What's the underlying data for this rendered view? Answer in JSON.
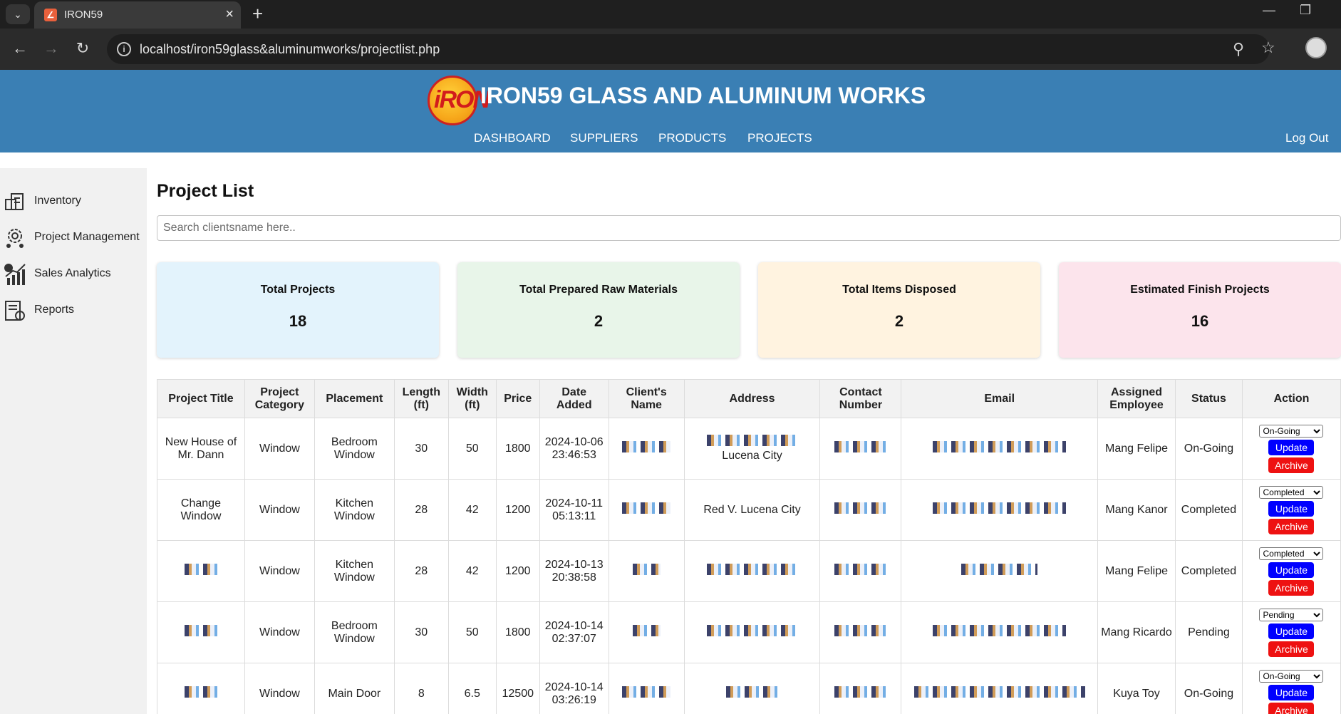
{
  "browser": {
    "tab_title": "IRON59",
    "url": "localhost/iron59glass&aluminumworks/projectlist.php"
  },
  "header": {
    "logo_text": "iRON",
    "title": "IRON59 GLASS AND ALUMINUM WORKS",
    "nav": [
      "DASHBOARD",
      "SUPPLIERS",
      "PRODUCTS",
      "PROJECTS"
    ],
    "logout": "Log Out"
  },
  "sidebar": {
    "items": [
      {
        "label": "Inventory",
        "icon": "inventory-icon"
      },
      {
        "label": "Project Management",
        "icon": "gear-people-icon"
      },
      {
        "label": "Sales Analytics",
        "icon": "chart-growth-icon"
      },
      {
        "label": "Reports",
        "icon": "report-icon"
      }
    ]
  },
  "main": {
    "title": "Project List",
    "search_placeholder": "Search clientsname here..",
    "cards": [
      {
        "label": "Total Projects",
        "value": "18",
        "color": "#e3f3fc"
      },
      {
        "label": "Total Prepared Raw Materials",
        "value": "2",
        "color": "#e8f5e9"
      },
      {
        "label": "Total Items Disposed",
        "value": "2",
        "color": "#fff3e0"
      },
      {
        "label": "Estimated Finish Projects",
        "value": "16",
        "color": "#fce4ec"
      }
    ],
    "table": {
      "headers": [
        "Project Title",
        "Project Category",
        "Placement",
        "Length (ft)",
        "Width (ft)",
        "Price",
        "Date Added",
        "Client's Name",
        "Address",
        "Contact Number",
        "Email",
        "Assigned Employee",
        "Status",
        "Action"
      ],
      "rows": [
        {
          "title": "New House of Mr. Dann",
          "category": "Window",
          "placement": "Bedroom Window",
          "length": "30",
          "width": "50",
          "price": "1800",
          "date": "2024-10-06 23:46:53",
          "address": "Lucena City",
          "employee": "Mang Felipe",
          "status": "On-Going",
          "select": "On-Going"
        },
        {
          "title": "Change Window",
          "category": "Window",
          "placement": "Kitchen Window",
          "length": "28",
          "width": "42",
          "price": "1200",
          "date": "2024-10-11 05:13:11",
          "address": "Red V. Lucena City",
          "employee": "Mang Kanor",
          "status": "Completed",
          "select": "Completed"
        },
        {
          "title": "",
          "category": "Window",
          "placement": "Kitchen Window",
          "length": "28",
          "width": "42",
          "price": "1200",
          "date": "2024-10-13 20:38:58",
          "address": "",
          "employee": "Mang Felipe",
          "status": "Completed",
          "select": "Completed"
        },
        {
          "title": "",
          "category": "Window",
          "placement": "Bedroom Window",
          "length": "30",
          "width": "50",
          "price": "1800",
          "date": "2024-10-14 02:37:07",
          "address": "",
          "employee": "Mang Ricardo",
          "status": "Pending",
          "select": "Pending"
        },
        {
          "title": "",
          "category": "Window",
          "placement": "Main Door",
          "length": "8",
          "width": "6.5",
          "price": "12500",
          "date": "2024-10-14 03:26:19",
          "address": "",
          "employee": "Kuya Toy",
          "status": "On-Going",
          "select": "On-Going"
        }
      ],
      "update_label": "Update",
      "archive_label": "Archive"
    }
  }
}
